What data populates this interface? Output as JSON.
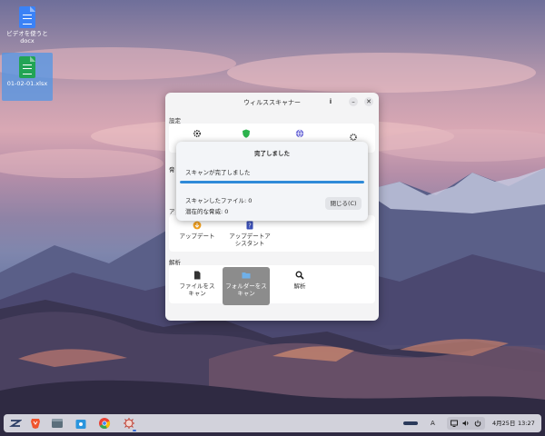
{
  "desktop": {
    "icons": [
      {
        "label_line1": "ビデオを使うと",
        "label_line2": "docx",
        "type": "doc-file-icon"
      },
      {
        "label_line1": "01-02-01.xlsx",
        "type": "sheet-file-icon"
      }
    ]
  },
  "window": {
    "title": "ウィルススキャナー",
    "info_glyph": "i",
    "minimize_glyph": "–",
    "close_glyph": "✕",
    "sections": {
      "settings_label": "設定",
      "section2_label": "脅",
      "section3_label": "ア",
      "update_label": "アップデート",
      "update_assistant_line1": "アップデートア",
      "update_assistant_line2": "シスタント",
      "analysis_label": "解析",
      "file_scan_line1": "ファイルをス",
      "file_scan_line2": "キャン",
      "folder_scan_line1": "フォルダーをス",
      "folder_scan_line2": "キャン",
      "analysis_item": "解析"
    }
  },
  "dialog": {
    "title": "完了しました",
    "status": "スキャンが完了しました",
    "progress_fraction": 1.0,
    "scanned_files": "スキャンしたファイル: 0",
    "potential_threats": "潜在的な脅威: 0",
    "close_button": "閉じる(C)"
  },
  "taskbar": {
    "apps": [
      "zorin-menu-icon",
      "brave-browser-icon",
      "files-icon",
      "software-store-icon",
      "chrome-icon",
      "virus-scanner-icon"
    ],
    "tray_input": "A",
    "date": "4月25日",
    "time": "13:27"
  },
  "colors": {
    "accent": "#2f8ad8",
    "active_tile": "#8c8c8c",
    "shield_green": "#2bb24c"
  }
}
